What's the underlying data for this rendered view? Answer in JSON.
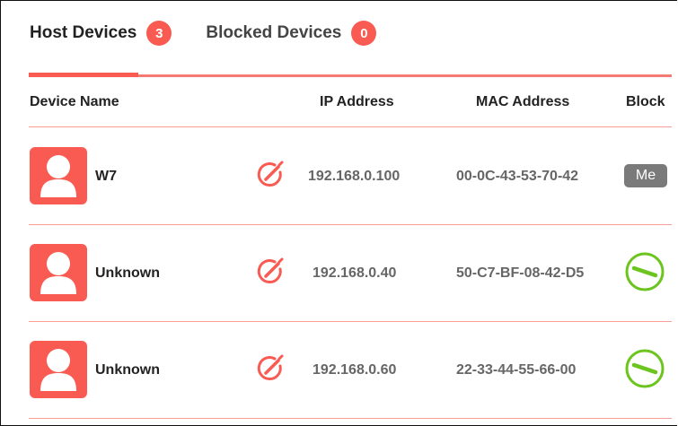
{
  "tabs": [
    {
      "label": "Host Devices",
      "count": "3"
    },
    {
      "label": "Blocked Devices",
      "count": "0"
    }
  ],
  "columns": {
    "device_name": "Device Name",
    "ip_address": "IP Address",
    "mac_address": "MAC Address",
    "block": "Block"
  },
  "devices": [
    {
      "name": "W7",
      "ip": "192.168.0.100",
      "mac": "00-0C-43-53-70-42",
      "block": "Me"
    },
    {
      "name": "Unknown",
      "ip": "192.168.0.40",
      "mac": "50-C7-BF-08-42-D5",
      "block": ""
    },
    {
      "name": "Unknown",
      "ip": "192.168.0.60",
      "mac": "22-33-44-55-66-00",
      "block": ""
    }
  ],
  "colors": {
    "accent": "#f95b52",
    "toggle_green": "#6cc51f",
    "me_badge": "#7a7a7a"
  },
  "icons": {
    "avatar": "user-avatar-icon",
    "edit": "edit-pencil-icon",
    "block": "block-toggle-icon"
  }
}
